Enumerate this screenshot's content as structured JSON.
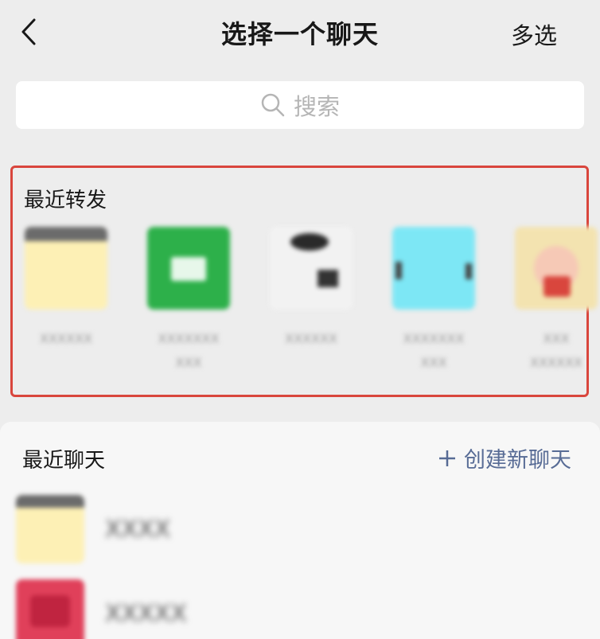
{
  "header": {
    "back_icon": "chevron-left-icon",
    "title": "选择一个聊天",
    "multi_select_label": "多选"
  },
  "search": {
    "icon": "search-icon",
    "placeholder": "搜索"
  },
  "recent_forward": {
    "label": "最近转发",
    "highlight_color": "#d9463d",
    "items": [
      {
        "name_line1": "XXXXXX",
        "name_line2": "",
        "color": "#fdf0b5"
      },
      {
        "name_line1": "XXXXXXX",
        "name_line2": "XXX",
        "color": "#2db04a"
      },
      {
        "name_line1": "XXXXXX",
        "name_line2": "",
        "color": "#f2f2f2"
      },
      {
        "name_line1": "XXXXXXX",
        "name_line2": "XXX",
        "color": "#7de7f5"
      },
      {
        "name_line1": "XXX",
        "name_line2": "XXXXXX",
        "color": "#f3e3b0"
      }
    ]
  },
  "recent_chats": {
    "label": "最近聊天",
    "create_label": "创建新聊天",
    "create_icon": "plus-icon",
    "accent_color": "#576b95",
    "items": [
      {
        "name": "XXXX",
        "color": "#fdf0b5"
      },
      {
        "name": "XXXXX",
        "color": "#e0405a"
      }
    ]
  }
}
